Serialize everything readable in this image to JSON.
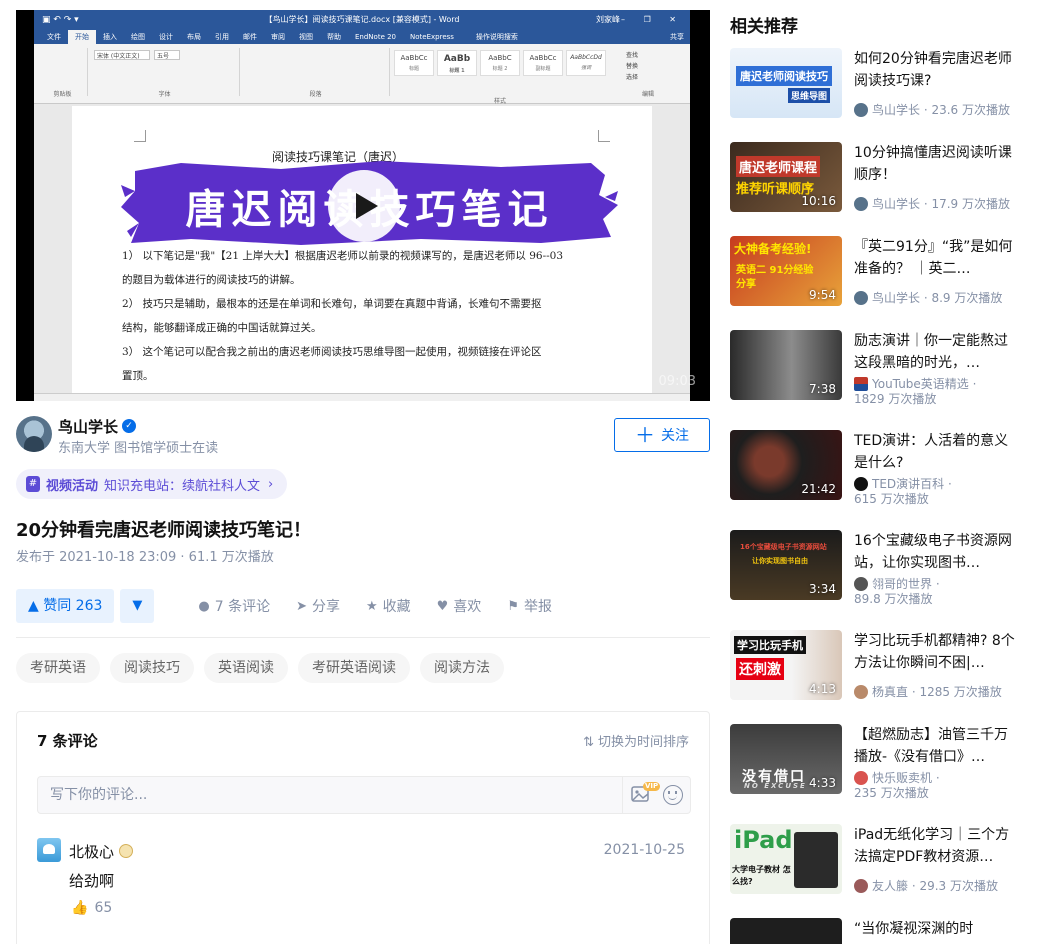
{
  "video": {
    "duration": "09:03",
    "word_window": {
      "title": "【鸟山学长】阅读技巧课笔记.docx [兼容模式] - Word",
      "user": "刘家峰",
      "tabs": [
        "文件",
        "开始",
        "插入",
        "绘图",
        "设计",
        "布局",
        "引用",
        "邮件",
        "审阅",
        "视图",
        "帮助",
        "EndNote 20",
        "NoteExpress"
      ],
      "tell_me": "操作说明搜索",
      "share": "共享",
      "groups": [
        "剪贴板",
        "字体",
        "段落",
        "样式",
        "编辑"
      ],
      "font_name": "宋体 (中文正文)",
      "font_size": "五号",
      "styles": [
        {
          "sample": "AaBbCc",
          "name": "标题"
        },
        {
          "sample": "AaBb",
          "name": "标题 1"
        },
        {
          "sample": "AaBbC",
          "name": "标题 2"
        },
        {
          "sample": "AaBbCc",
          "name": "副标题"
        },
        {
          "sample": "AaBbCcDd",
          "name": "强调"
        }
      ],
      "edit_items": [
        "查找",
        "替换",
        "选择"
      ]
    },
    "doc": {
      "heading": "阅读技巧课笔记（唐迟）",
      "lines": [
        "1）  以下笔记是\"我\"【21 上岸大大】根据唐迟老师以前录的视频课写的，是唐迟老师以 96--03",
        "      的题目为载体进行的阅读技巧的讲解。",
        "2）  技巧只是辅助，最根本的还是在单词和长难句，单词要在真题中背诵，长难句不需要抠",
        "      结构，能够翻译成正确的中国话就算过关。",
        "3）  这个笔记可以配合我之前出的唐迟老师阅读技巧思维导图一起使用，视频链接在评论区",
        "      置顶。"
      ]
    },
    "banner_text": "唐迟阅读技巧笔记"
  },
  "author": {
    "name": "鸟山学长",
    "desc": "东南大学 图书馆学硕士在读",
    "follow_label": "关注"
  },
  "activity": {
    "label": "视频活动",
    "value": "知识充电站：续航社科人文"
  },
  "title": "20分钟看完唐迟老师阅读技巧笔记！",
  "meta": "发布于 2021-10-18 23:09 · 61.1 万次播放",
  "actions": {
    "upvote": "▲ 赞同 263",
    "downvote": "▼",
    "comments": "7 条评论",
    "share": "分享",
    "favorite": "收藏",
    "like": "喜欢",
    "report": "举报"
  },
  "tags": [
    "考研英语",
    "阅读技巧",
    "英语阅读",
    "考研英语阅读",
    "阅读方法"
  ],
  "comments": {
    "count_label": "7 条评论",
    "sort_label": "切换为时间排序",
    "placeholder": "写下你的评论...",
    "vip": "VIP",
    "items": [
      {
        "author": "北极心",
        "date": "2021-10-25",
        "text": "给劲啊",
        "likes": "65"
      }
    ]
  },
  "sidebar": {
    "title": "相关推荐",
    "items": [
      {
        "title": "如何20分钟看完唐迟老师阅读技巧课?",
        "author": "鸟山学长 · 23.6 万次播放",
        "duration": "",
        "thumb_text": "唐迟老师阅读技巧",
        "thumb_sub": "思维导图"
      },
      {
        "title": "10分钟搞懂唐迟阅读听课顺序！",
        "author": "鸟山学长 · 17.9 万次播放",
        "duration": "10:16",
        "thumb_text": "唐迟老师课程",
        "thumb_sub": "推荐听课顺序"
      },
      {
        "title": "『英二91分』“我”是如何准备的？ ｜英二…",
        "author": "鸟山学长 · 8.9 万次播放",
        "duration": "9:54",
        "thumb_text": "大神备考经验!",
        "thumb_sub": "英语二 91分经验分享"
      },
      {
        "title": "励志演讲｜你一定能熬过这段黑暗的时光，…",
        "author": "YouTube英语精选 ·",
        "author2": "1829 万次播放",
        "duration": "7:38",
        "thumb_text": "",
        "thumb_sub": ""
      },
      {
        "title": "TED演讲：人活着的意义是什么?",
        "author": "TED演讲百科 ·",
        "author2": "615 万次播放",
        "duration": "21:42",
        "thumb_text": "",
        "thumb_sub": ""
      },
      {
        "title": "16个宝藏级电子书资源网站，让你实现图书…",
        "author": "翎哥的世界 ·",
        "author2": "89.8 万次播放",
        "duration": "3:34",
        "thumb_text": "16个宝藏级电子书资源网站",
        "thumb_sub": "让你实现图书自由"
      },
      {
        "title": "学习比玩手机都精神? 8个方法让你瞬间不困|…",
        "author": "杨真直 · 1285 万次播放",
        "duration": "4:13",
        "thumb_text": "学习比玩手机",
        "thumb_sub": "还刺激"
      },
      {
        "title": "【超燃励志】油管三千万播放-《没有借口》…",
        "author": "快乐贩卖机 ·",
        "author2": "235 万次播放",
        "duration": "4:33",
        "thumb_text": "没有借口",
        "thumb_sub": "NO EXCUSE"
      },
      {
        "title": "iPad无纸化学习｜三个方法搞定PDF教材资源…",
        "author": "友人籐 · 29.3 万次播放",
        "duration": "",
        "thumb_text": "iPad",
        "thumb_sub": "大学电子教材 怎么找?"
      },
      {
        "title": "“当你凝视深渊的时",
        "author": "",
        "duration": "",
        "thumb_text": "",
        "thumb_sub": ""
      }
    ]
  },
  "colors": {
    "brand_blue": "#056de8",
    "banner_purple": "#5b2fc9",
    "activity_purple": "#5c4cd6",
    "muted_text": "#8590a6"
  }
}
